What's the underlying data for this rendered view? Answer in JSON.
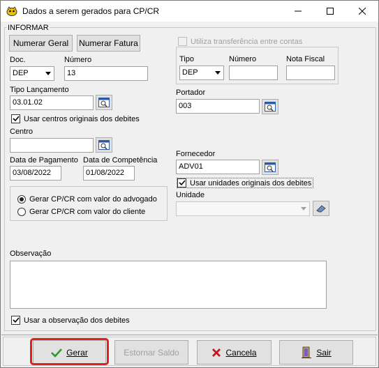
{
  "window": {
    "title": "Dados a serem gerados para CP/CR",
    "minimize_icon": "minimize-icon",
    "maximize_icon": "maximize-icon",
    "close_icon": "close-icon"
  },
  "group_title": "INFORMAR",
  "buttons": {
    "numerar_geral": "Numerar Geral",
    "numerar_fatura": "Numerar Fatura"
  },
  "doc": {
    "label": "Doc.",
    "value": "DEP"
  },
  "numero": {
    "label": "Número",
    "value": "13"
  },
  "tipo_lancamento": {
    "label": "Tipo Lançamento",
    "value": "03.01.02"
  },
  "usar_centros": {
    "label": "Usar centros originais dos debites",
    "checked": true
  },
  "centro": {
    "label": "Centro",
    "value": ""
  },
  "data_pagamento": {
    "label": "Data de Pagamento",
    "value": "03/08/2022"
  },
  "data_competencia": {
    "label": "Data de Competência",
    "value": "01/08/2022"
  },
  "radios": {
    "advogado": "Gerar CP/CR com valor do advogado",
    "cliente": "Gerar CP/CR com valor do cliente",
    "selected": "advogado"
  },
  "transferencia": {
    "label": "Utiliza transferência entre contas",
    "checked": false,
    "enabled": false,
    "tipo_label": "Tipo",
    "tipo_value": "DEP",
    "numero_label": "Número",
    "numero_value": "",
    "nota_fiscal_label": "Nota Fiscal",
    "nota_fiscal_value": ""
  },
  "portador": {
    "label": "Portador",
    "value": "003"
  },
  "fornecedor": {
    "label": "Fornecedor",
    "value": "ADV01"
  },
  "usar_unidades": {
    "label": "Usar unidades originais dos debites",
    "checked": true
  },
  "unidade": {
    "label": "Unidade",
    "value": ""
  },
  "observacao": {
    "label": "Observação",
    "value": ""
  },
  "usar_observacao": {
    "label": "Usar a observação dos debites",
    "checked": true
  },
  "footer": {
    "gerar": "Gerar",
    "estornar_saldo": "Estornar Saldo",
    "cancela": "Cancela",
    "sair": "Sair"
  },
  "colors": {
    "highlight": "#e0211b",
    "check_green": "#2e9a2e",
    "cancel_red": "#c4161c"
  }
}
